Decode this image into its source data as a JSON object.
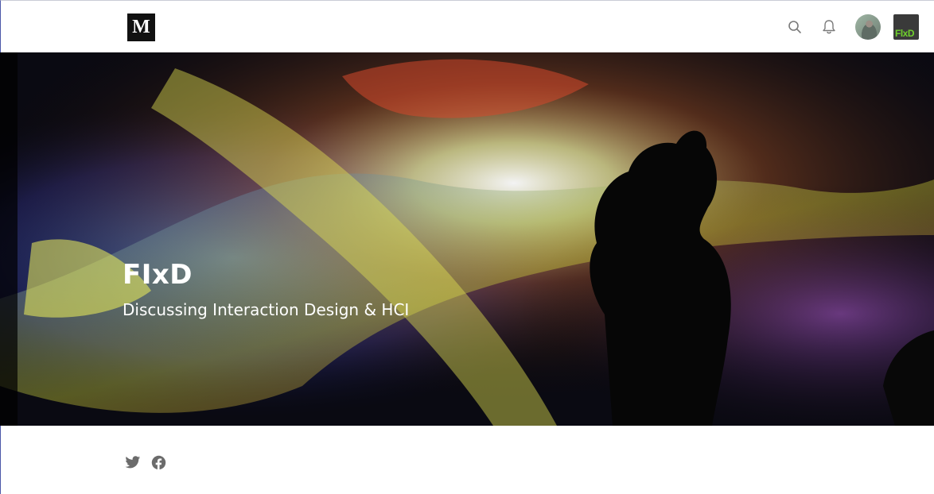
{
  "app": {
    "logo_text": "M",
    "icons": {
      "search": "search-icon",
      "notifications": "bell-icon",
      "avatar": "avatar",
      "publication": "publication-thumbnail"
    },
    "publication_thumb_text": "FlxD"
  },
  "hero": {
    "title": "FIxD",
    "subtitle": "Discussing Interaction Design & HCI"
  },
  "social": {
    "twitter": "twitter-icon",
    "facebook": "facebook-icon"
  },
  "colors": {
    "icon_gray": "#7a7a7a",
    "logo_bg": "#111111",
    "accent_green": "#6fcf2c"
  }
}
